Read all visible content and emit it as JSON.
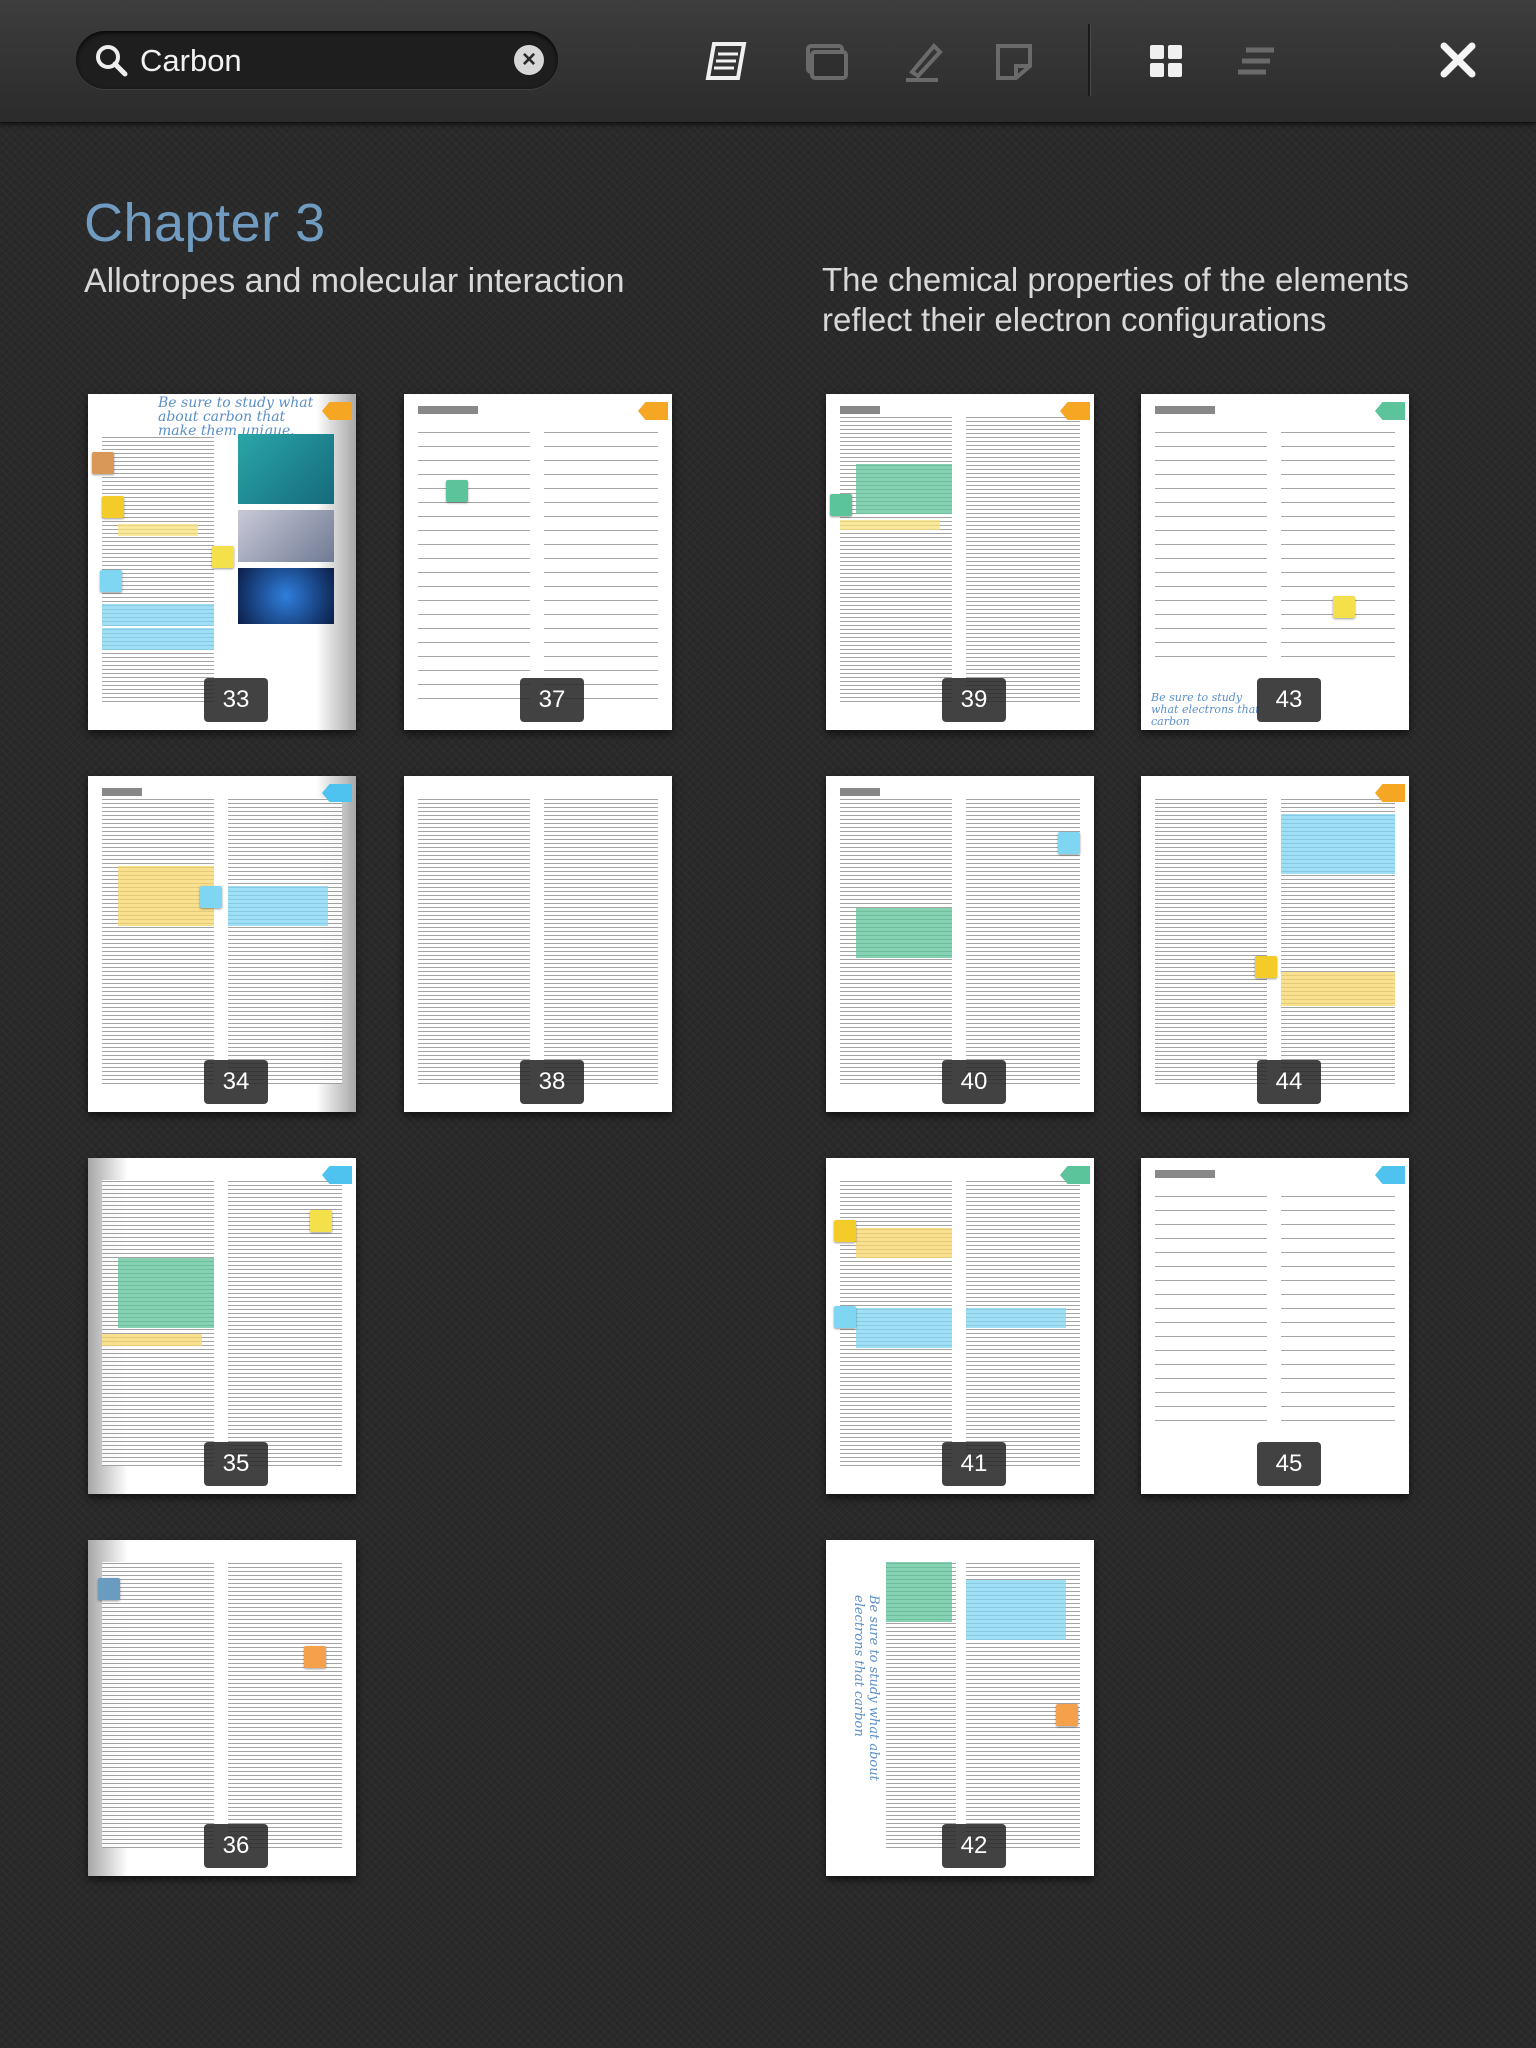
{
  "search": {
    "value": "Carbon",
    "placeholder": "Search"
  },
  "toolbar": {
    "icons": [
      "notebook-icon",
      "bookmarks-icon",
      "highlight-pen-icon",
      "sticky-note-icon",
      "grid-view-icon",
      "list-view-icon",
      "close-icon"
    ]
  },
  "chapter": {
    "number": "Chapter 3",
    "sections": [
      "Allotropes and molecular interaction",
      "The chemical properties of the elements reflect their electron configurations"
    ]
  },
  "pages": [
    {
      "n": "33",
      "tag": "#f5a623"
    },
    {
      "n": "37",
      "tag": "#f5a623"
    },
    {
      "n": "39",
      "tag": "#f5a623"
    },
    {
      "n": "43",
      "tag": "#5cc49a"
    },
    {
      "n": "34",
      "tag": "#4ec3f0"
    },
    {
      "n": "38",
      "tag": ""
    },
    {
      "n": "40",
      "tag": ""
    },
    {
      "n": "44",
      "tag": "#f5a623"
    },
    {
      "n": "35",
      "tag": "#4ec3f0"
    },
    {
      "n": "41",
      "tag": "#5cc49a"
    },
    {
      "n": "45",
      "tag": "#4ec3f0"
    },
    {
      "n": "36",
      "tag": ""
    },
    {
      "n": "42",
      "tag": ""
    }
  ],
  "handwriting": {
    "p33": "Be sure to study what about carbon that make them unique.",
    "p43": "Be sure to study what electrons that carbon",
    "p42": "Be sure to study what about electrons that carbon"
  }
}
